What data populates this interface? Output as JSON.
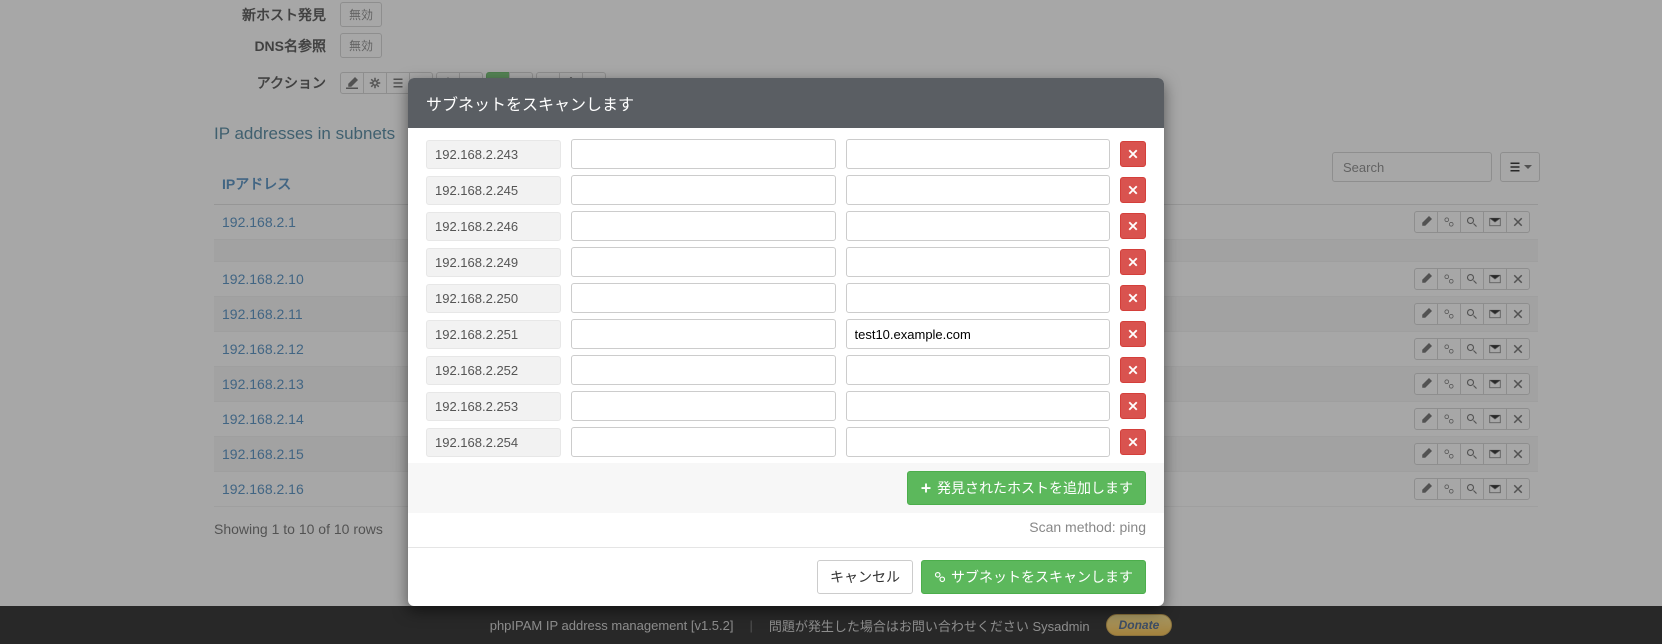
{
  "form": {
    "new_host_label": "新ホスト発見",
    "new_host_value": "無効",
    "dns_label": "DNS名参照",
    "dns_value": "無効",
    "actions_label": "アクション"
  },
  "section_title": "IP addresses in subnets",
  "search": {
    "placeholder": "Search"
  },
  "table": {
    "header": "IPアドレス",
    "rows": [
      {
        "ip": "192.168.2.1",
        "shaded": false,
        "spacer_after": true
      },
      {
        "ip": "192.168.2.10",
        "shaded": false
      },
      {
        "ip": "192.168.2.11",
        "shaded": true
      },
      {
        "ip": "192.168.2.12",
        "shaded": false
      },
      {
        "ip": "192.168.2.13",
        "shaded": true
      },
      {
        "ip": "192.168.2.14",
        "shaded": false
      },
      {
        "ip": "192.168.2.15",
        "shaded": true
      },
      {
        "ip": "192.168.2.16",
        "shaded": false
      }
    ]
  },
  "pager": "Showing 1 to 10 of 10 rows",
  "footer": {
    "app": "phpIPAM IP address management [v1.5.2]",
    "contact": "問題が発生した場合はお問い合わせください Sysadmin",
    "donate": "Donate"
  },
  "modal": {
    "title": "サブネットをスキャンします",
    "rows": [
      {
        "ip": "192.168.2.243",
        "desc": "",
        "host": ""
      },
      {
        "ip": "192.168.2.245",
        "desc": "",
        "host": ""
      },
      {
        "ip": "192.168.2.246",
        "desc": "",
        "host": ""
      },
      {
        "ip": "192.168.2.249",
        "desc": "",
        "host": ""
      },
      {
        "ip": "192.168.2.250",
        "desc": "",
        "host": ""
      },
      {
        "ip": "192.168.2.251",
        "desc": "",
        "host": "test10.example.com"
      },
      {
        "ip": "192.168.2.252",
        "desc": "",
        "host": ""
      },
      {
        "ip": "192.168.2.253",
        "desc": "",
        "host": ""
      },
      {
        "ip": "192.168.2.254",
        "desc": "",
        "host": ""
      }
    ],
    "add_label": "発見されたホストを追加します",
    "scan_note": "Scan method: ping",
    "cancel": "キャンセル",
    "scan": "サブネットをスキャンします"
  }
}
